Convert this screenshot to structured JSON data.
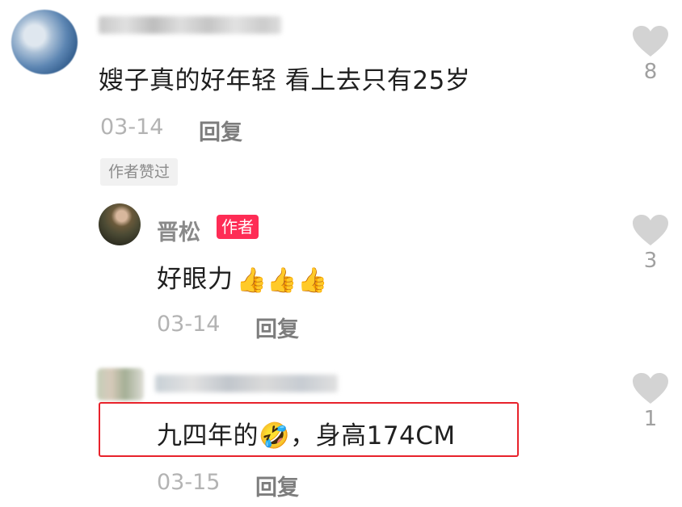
{
  "comment": {
    "text": "嫂子真的好年轻 看上去只有25岁",
    "date": "03-14",
    "reply_label": "回复",
    "author_liked_label": "作者赞过",
    "like_count": "8"
  },
  "replies": [
    {
      "username": "晋松",
      "badge": "作者",
      "text": "好眼力",
      "emoji": "👍👍👍",
      "date": "03-14",
      "reply_label": "回复",
      "like_count": "3"
    },
    {
      "text_before_emoji": "九四年的",
      "emoji": "🤣",
      "text_after_emoji": "，身高174CM",
      "date": "03-15",
      "reply_label": "回复",
      "like_count": "1"
    }
  ],
  "colors": {
    "highlight_border": "#e8222b",
    "author_badge": "#fe2c55",
    "heart": "#d3d3d3"
  }
}
